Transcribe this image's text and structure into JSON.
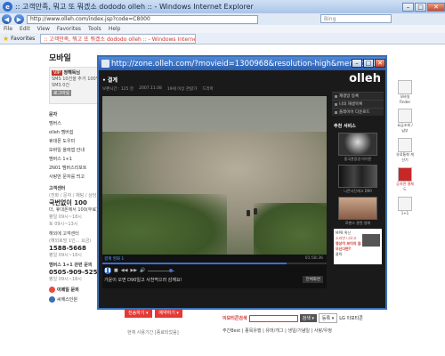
{
  "browser": {
    "window_title": ":: 고객만족, 뭐고 또 뭐겠소 dododo olleh :: - Windows Internet Explorer",
    "url": "http://www.olleh.com/index.jsp?code=C8000",
    "search_placeholder": "Bing",
    "menu": [
      "File",
      "Edit",
      "View",
      "Favorites",
      "Tools",
      "Help"
    ],
    "favorites_label": "Favorites",
    "tab_title": ":: 고객만족, 뭐고 또 뭐겠소 dododo olleh :: - Windows Internet Explorer"
  },
  "page": {
    "section_title": "모바일",
    "login_badge": "VIP",
    "login_name": "정해득님",
    "login_line2": "SMS 10건을 추가 100%",
    "login_line3": "SMS 0건",
    "login_btn": "로그아웃",
    "links_top": "문자",
    "links": [
      "멤버스",
      "olleh 멤버쉽",
      "휴대폰 도우미",
      "모바일 올레앱 안내",
      "멤버스 1+1",
      "2N01 멤버스리포트",
      "사랑만 문자를 띄고"
    ],
    "cs_title": "고객센터",
    "cs_sub": "(전화 / 문자 / 채팅 / 상담...)",
    "cs_num1_label": "국번없이 100",
    "cs_num1_desc": "더, 휴대폰에서 100(무료)",
    "cs_hours1": "평일 09시~18시",
    "cs_hours2": "토 09시~13시",
    "cs_ars_label": "해외에 고객센터",
    "cs_ars_desc": "(해외로밍 1인... 요금)",
    "cs_num2": "1588-5668",
    "cs_hours3": "평일 09시~18시",
    "cs_rel_title": "멤버스 1+1 관련 문의",
    "cs_num3": "0505-909-5252",
    "cs_hours4": "평일 09시~18시",
    "chat1": "이메일 문의",
    "chat2": "씨에스인원",
    "rail": [
      "모바일 Finder",
      "요금조회 / 납부",
      "유료통화 계산기",
      "공지면 결제도",
      "1+1"
    ],
    "btn_red1": "전송하기 ▾",
    "btn_red2": "예약하기 ▾",
    "search_label": "이모티콘검색",
    "search_btn": "검색 ▾",
    "search_btn2": "등록 ▾",
    "search_opt": "LG 이모티콘",
    "cat_row": "주간Best | 종목유행 | 유머/개그 | 생일/기념일 | 사랑/우정",
    "bottom_text": "현재 사용기간 [종료되었음]"
  },
  "modal": {
    "title": "http://zone.olleh.com/?movieid=1300968&resolution-high&menuid=1...",
    "movie_title": "• 결계",
    "meta": [
      "보편시간 : 125 분",
      "2007.11.08",
      "19세 이상 관람가",
      "드라마"
    ],
    "sub_top": "결계 영화 1",
    "time": "01:58:36",
    "progress": 0.82,
    "volume": 0.85,
    "subtitle": "가윤이 오면 D90일고 사천먹으러 감께요!",
    "fullscreen_btn": "전체화면",
    "brand": "olleh",
    "side_btns": [
      "재생방 등록",
      "나의 재생목록",
      "플레이어 다운로드"
    ],
    "rec_title": "추천 서비스",
    "rec_caps": [
      "중국관광경 아이폰",
      "니콘사진캐고 D90",
      "로맨스 관련 영화"
    ],
    "ad_text1": "MPB 확산",
    "ad_text2": "소리만 나오고",
    "ad_text3": "영상이 보이지 않으신다면?",
    "ad_text4": "클릭"
  },
  "colors": {
    "accent": "#3b6fb5",
    "brand_red": "#e53935"
  }
}
